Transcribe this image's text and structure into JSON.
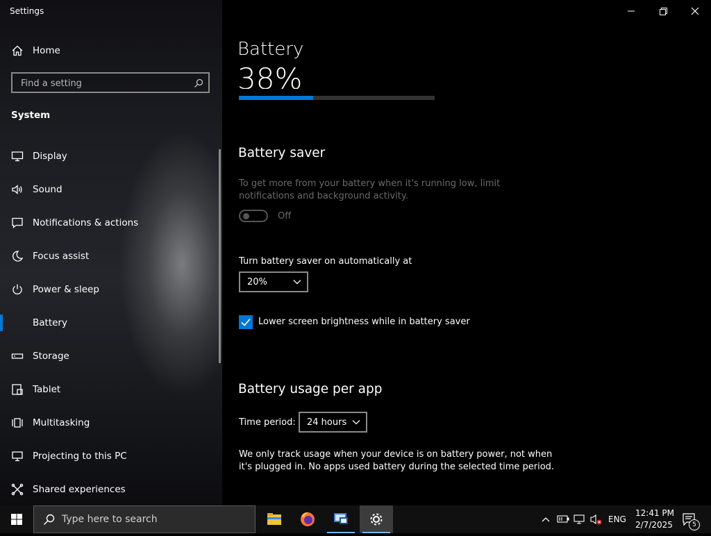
{
  "window": {
    "title": "Settings"
  },
  "sidebar": {
    "home_label": "Home",
    "search_placeholder": "Find a setting",
    "section_title": "System",
    "items": [
      {
        "label": "Display",
        "icon": "display-icon"
      },
      {
        "label": "Sound",
        "icon": "speaker-icon"
      },
      {
        "label": "Notifications & actions",
        "icon": "notification-icon"
      },
      {
        "label": "Focus assist",
        "icon": "moon-icon"
      },
      {
        "label": "Power & sleep",
        "icon": "power-icon"
      },
      {
        "label": "Battery",
        "icon": "battery-icon",
        "selected": true
      },
      {
        "label": "Storage",
        "icon": "storage-icon"
      },
      {
        "label": "Tablet",
        "icon": "tablet-icon"
      },
      {
        "label": "Multitasking",
        "icon": "multitasking-icon"
      },
      {
        "label": "Projecting to this PC",
        "icon": "projecting-icon"
      },
      {
        "label": "Shared experiences",
        "icon": "shared-icon"
      }
    ]
  },
  "main": {
    "title": "Battery",
    "battery_percent_label": "38%",
    "battery_level": 0.38,
    "saver_heading": "Battery saver",
    "saver_description": "To get more from your battery when it's running low, limit notifications and background activity.",
    "saver_toggle_label": "Off",
    "auto_label": "Turn battery saver on automatically at",
    "auto_value": "20%",
    "brightness_label": "Lower screen brightness while in battery saver",
    "brightness_checked": true,
    "usage_heading": "Battery usage per app",
    "time_period_label": "Time period:",
    "time_period_value": "24 hours",
    "usage_note": "We only track usage when your device is on battery power, not when it's plugged in. No apps used battery during the selected time period."
  },
  "taskbar": {
    "search_placeholder": "Type here to search",
    "apps": [
      "file-explorer-icon",
      "firefox-icon",
      "remote-desktop-icon",
      "settings-gear-icon"
    ],
    "language": "ENG",
    "time": "12:41 PM",
    "date": "2/7/2025",
    "notification_count": "5"
  },
  "colors": {
    "accent": "#0078d7",
    "background": "#000000",
    "taskbar": "#101010"
  }
}
